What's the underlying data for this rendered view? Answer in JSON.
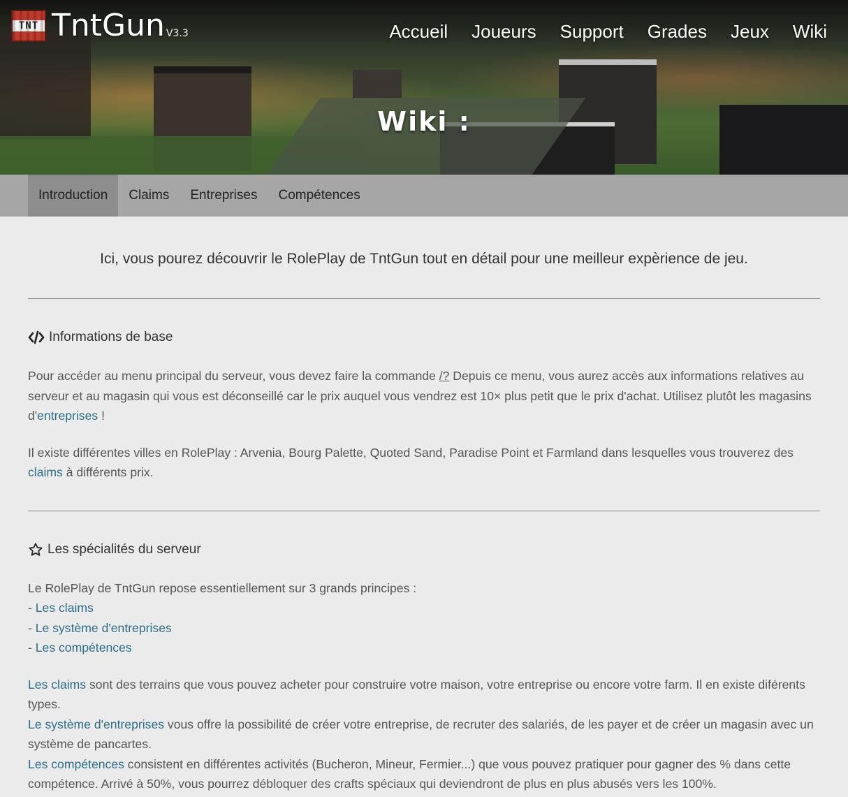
{
  "header": {
    "brand": "TntGun",
    "version": "V3.3",
    "logo_text": "TNT",
    "nav": [
      "Accueil",
      "Joueurs",
      "Support",
      "Grades",
      "Jeux",
      "Wiki"
    ],
    "hero_title": "Wiki :"
  },
  "tabs": [
    "Introduction",
    "Claims",
    "Entreprises",
    "Compétences"
  ],
  "active_tab": "Introduction",
  "intro": "Ici, vous pourez découvrir le RolePlay de TntGun tout en détail pour une meilleur expèrience de jeu.",
  "section1": {
    "title": "Informations de base",
    "icon": "code-icon",
    "p1_a": "Pour accéder au menu principal du serveur, vous devez faire la commande ",
    "p1_cmd": "/?",
    "p1_b": " Depuis ce menu, vous aurez accès aux informations relatives au serveur et au magasin qui vous est déconseillé car le prix auquel vous vendrez est 10× plus petit que le prix d'achat. Utilisez plutôt les magasins d'",
    "p1_link": "entreprises",
    "p1_c": " !",
    "p2_a": "Il existe différentes villes en RolePlay : Arvenia, Bourg Palette, Quoted Sand, Paradise Point et Farmland dans lesquelles vous trouverez des ",
    "p2_link": "claims",
    "p2_b": " à différents prix."
  },
  "section2": {
    "title": "Les spécialités du serveur",
    "icon": "star-icon",
    "lead": "Le RolePlay de TntGun repose essentiellement sur 3 grands principes :",
    "dash": "- ",
    "list": [
      "Les claims",
      "Le système d'entreprises",
      "Les compétences"
    ],
    "d1_link": "Les claims",
    "d1_text": " sont des terrains que vous pouvez acheter pour construire votre maison, votre entreprise ou encore votre farm. Il en existe diférents types.",
    "d2_link": "Le système d'entreprises",
    "d2_text": " vous offre la possibilité de créer votre entreprise, de recruter des salariés, de les payer et de créer un magasin avec un système de pancartes.",
    "d3_link": "Les compétences",
    "d3_text": " consistent en différentes activités (Bucheron, Mineur, Fermier...) que vous pouvez pratiquer pour gagner des % dans cette compétence. Arrivé à 50%, vous pourrez débloquer des crafts spéciaux qui deviendront de plus en plus abusés vers les 100%."
  }
}
